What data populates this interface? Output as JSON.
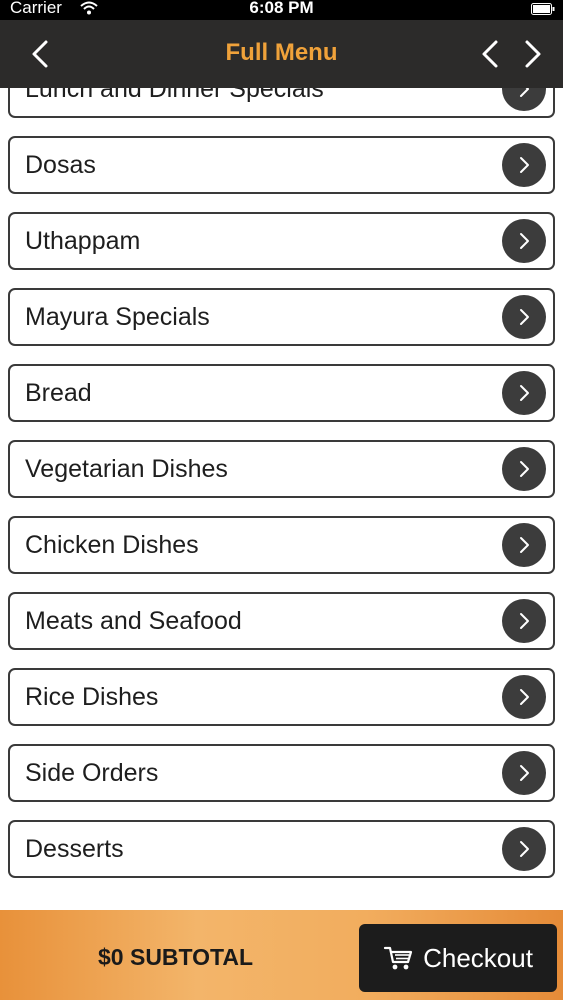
{
  "status_bar": {
    "carrier": "Carrier",
    "time": "6:08 PM"
  },
  "nav": {
    "title": "Full Menu"
  },
  "menu": {
    "items": [
      {
        "label": "Lunch and Dinner Specials"
      },
      {
        "label": "Dosas"
      },
      {
        "label": "Uthappam"
      },
      {
        "label": "Mayura Specials"
      },
      {
        "label": "Bread"
      },
      {
        "label": "Vegetarian Dishes"
      },
      {
        "label": "Chicken Dishes"
      },
      {
        "label": "Meats and Seafood"
      },
      {
        "label": "Rice Dishes"
      },
      {
        "label": "Side Orders"
      },
      {
        "label": "Desserts"
      }
    ]
  },
  "footer": {
    "subtotal": "$0 SUBTOTAL",
    "checkout_label": "Checkout"
  },
  "colors": {
    "accent": "#f0a23a",
    "nav_background": "#2c2b2a",
    "chevron_background": "#3c3c3c",
    "checkout_background": "#1c1c1c"
  },
  "icons": {
    "back": "chevron-left-icon",
    "prev": "chevron-left-icon",
    "next": "chevron-right-icon",
    "row": "chevron-right-icon",
    "cart": "cart-icon"
  }
}
